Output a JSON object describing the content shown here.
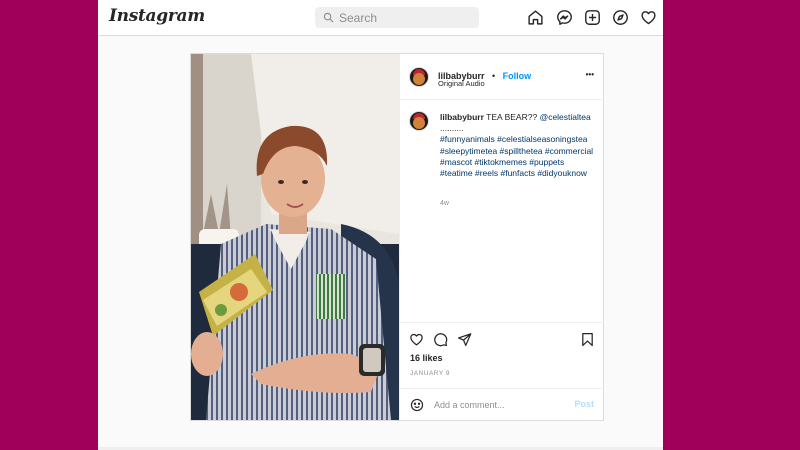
{
  "app": {
    "logo": "Instagram"
  },
  "search": {
    "placeholder": "Search"
  },
  "nav": {
    "icons": [
      "home-icon",
      "messenger-icon",
      "new-post-icon",
      "explore-icon",
      "activity-icon"
    ]
  },
  "post": {
    "author": {
      "username": "lilbabyburr",
      "follow_label": "Follow",
      "separator": "•",
      "audio": "Original Audio"
    },
    "more_label": "•••",
    "caption": {
      "username": "lilbabyburr",
      "text": "TEA BEAR??",
      "mention": "@celestialtea",
      "dots": "..........",
      "hashtags": "#funnyanimals #celestialseasoningstea #sleepytimetea #spillthetea #commercial #mascot #tiktokmemes #puppets #teatime #reels #funfacts #didyouknow",
      "age": "4w"
    },
    "likes": "16 likes",
    "date": "JANUARY 9",
    "comment": {
      "placeholder": "Add a comment...",
      "post_label": "Post"
    }
  },
  "colors": {
    "background": "#a0005a",
    "link": "#0095f6",
    "hashtag": "#00376b",
    "post_disabled": "#b2dffc"
  }
}
